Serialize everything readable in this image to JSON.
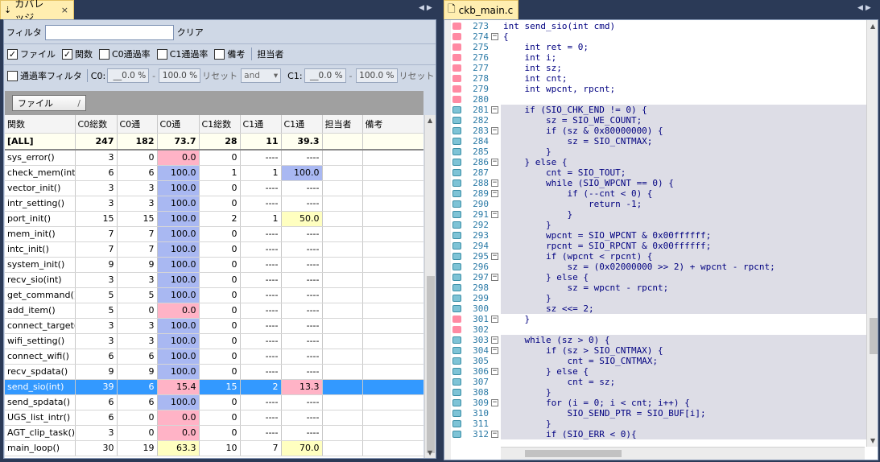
{
  "left_tab": {
    "title": "カバレッジ",
    "pin": "⇣",
    "close": "×"
  },
  "right_tab": {
    "title": "ckb_main.c"
  },
  "filter": {
    "label": "フィルタ",
    "value": "",
    "clear": "クリア"
  },
  "checks": [
    {
      "label": "ファイル",
      "checked": true
    },
    {
      "label": "関数",
      "checked": true
    },
    {
      "label": "C0通過率",
      "checked": false
    },
    {
      "label": "C1通過率",
      "checked": false
    },
    {
      "label": "備考",
      "checked": false
    }
  ],
  "owner_label": "担当者",
  "rate_filter": {
    "label": "通過率フィルタ",
    "c0_label": "C0:",
    "c0_min": "__0.0 %",
    "c0_max": "100.0 %",
    "reset": "リセット",
    "combine": "and",
    "c1_label": "C1:",
    "c1_min": "__0.0 %",
    "c1_max": "100.0 %",
    "reset2": "リセット",
    "dash": "-"
  },
  "file_button": "ファイル",
  "table": {
    "headers": [
      "関数",
      "C0総数",
      "C0通",
      "C0通",
      "C1総数",
      "C1通",
      "C1通",
      "担当者",
      "備考"
    ],
    "all_row": [
      "[ALL]",
      "247",
      "182",
      "73.7",
      "28",
      "11",
      "39.3",
      "",
      ""
    ],
    "rows": [
      [
        "sys_error()",
        "3",
        "0",
        "0.0",
        "0",
        "----",
        "----"
      ],
      [
        "check_mem(int)",
        "6",
        "6",
        "100.0",
        "1",
        "1",
        "100.0"
      ],
      [
        "vector_init()",
        "3",
        "3",
        "100.0",
        "0",
        "----",
        "----"
      ],
      [
        "intr_setting()",
        "3",
        "3",
        "100.0",
        "0",
        "----",
        "----"
      ],
      [
        "port_init()",
        "15",
        "15",
        "100.0",
        "2",
        "1",
        "50.0"
      ],
      [
        "mem_init()",
        "7",
        "7",
        "100.0",
        "0",
        "----",
        "----"
      ],
      [
        "intc_init()",
        "7",
        "7",
        "100.0",
        "0",
        "----",
        "----"
      ],
      [
        "system_init()",
        "9",
        "9",
        "100.0",
        "0",
        "----",
        "----"
      ],
      [
        "recv_sio(int)",
        "3",
        "3",
        "100.0",
        "0",
        "----",
        "----"
      ],
      [
        "get_command()",
        "5",
        "5",
        "100.0",
        "0",
        "----",
        "----"
      ],
      [
        "add_item()",
        "5",
        "0",
        "0.0",
        "0",
        "----",
        "----"
      ],
      [
        "connect_target()",
        "3",
        "3",
        "100.0",
        "0",
        "----",
        "----"
      ],
      [
        "wifi_setting()",
        "3",
        "3",
        "100.0",
        "0",
        "----",
        "----"
      ],
      [
        "connect_wifi()",
        "6",
        "6",
        "100.0",
        "0",
        "----",
        "----"
      ],
      [
        "recv_spdata()",
        "9",
        "9",
        "100.0",
        "0",
        "----",
        "----"
      ],
      [
        "send_sio(int)",
        "39",
        "6",
        "15.4",
        "15",
        "2",
        "13.3"
      ],
      [
        "send_spdata()",
        "6",
        "6",
        "100.0",
        "0",
        "----",
        "----"
      ],
      [
        "UGS_list_intr()",
        "6",
        "0",
        "0.0",
        "0",
        "----",
        "----"
      ],
      [
        "AGT_clip_task()",
        "3",
        "0",
        "0.0",
        "0",
        "----",
        "----"
      ],
      [
        "main_loop()",
        "30",
        "19",
        "63.3",
        "10",
        "7",
        "70.0"
      ]
    ]
  },
  "code": [
    {
      "n": "273",
      "t": "int send_sio(int cmd)"
    },
    {
      "n": "274",
      "t": "{"
    },
    {
      "n": "275",
      "t": "    int ret = 0;"
    },
    {
      "n": "276",
      "t": "    int i;"
    },
    {
      "n": "277",
      "t": "    int sz;"
    },
    {
      "n": "278",
      "t": "    int cnt;"
    },
    {
      "n": "279",
      "t": "    int wpcnt, rpcnt;"
    },
    {
      "n": "280",
      "t": ""
    },
    {
      "n": "281",
      "t": "    if (SIO_CHK_END != 0) {"
    },
    {
      "n": "282",
      "t": "        sz = SIO_WE_COUNT;"
    },
    {
      "n": "283",
      "t": "        if (sz & 0x80000000) {"
    },
    {
      "n": "284",
      "t": "            sz = SIO_CNTMAX;"
    },
    {
      "n": "285",
      "t": "        }"
    },
    {
      "n": "286",
      "t": "    } else {"
    },
    {
      "n": "287",
      "t": "        cnt = SIO_TOUT;"
    },
    {
      "n": "288",
      "t": "        while (SIO_WPCNT == 0) {"
    },
    {
      "n": "289",
      "t": "            if (--cnt < 0) {"
    },
    {
      "n": "290",
      "t": "                return -1;"
    },
    {
      "n": "291",
      "t": "            }"
    },
    {
      "n": "292",
      "t": "        }"
    },
    {
      "n": "293",
      "t": "        wpcnt = SIO_WPCNT & 0x00ffffff;"
    },
    {
      "n": "294",
      "t": "        rpcnt = SIO_RPCNT & 0x00ffffff;"
    },
    {
      "n": "295",
      "t": "        if (wpcnt < rpcnt) {"
    },
    {
      "n": "296",
      "t": "            sz = (0x02000000 >> 2) + wpcnt - rpcnt;"
    },
    {
      "n": "297",
      "t": "        } else {"
    },
    {
      "n": "298",
      "t": "            sz = wpcnt - rpcnt;"
    },
    {
      "n": "299",
      "t": "        }"
    },
    {
      "n": "300",
      "t": "        sz <<= 2;"
    },
    {
      "n": "301",
      "t": "    }"
    },
    {
      "n": "302",
      "t": ""
    },
    {
      "n": "303",
      "t": "    while (sz > 0) {"
    },
    {
      "n": "304",
      "t": "        if (sz > SIO_CNTMAX) {"
    },
    {
      "n": "305",
      "t": "            cnt = SIO_CNTMAX;"
    },
    {
      "n": "306",
      "t": "        } else {"
    },
    {
      "n": "307",
      "t": "            cnt = sz;"
    },
    {
      "n": "308",
      "t": "        }"
    },
    {
      "n": "309",
      "t": "        for (i = 0; i < cnt; i++) {"
    },
    {
      "n": "310",
      "t": "            SIO_SEND_PTR = SIO_BUF[i];"
    },
    {
      "n": "311",
      "t": "        }"
    },
    {
      "n": "312",
      "t": "        if (SIO_ERR < 0){"
    }
  ],
  "colors": {
    "covered_bg": "#dddde6",
    "uncovered_bg": "#ffffff",
    "selection": "#3399ff",
    "pct_zero": "#ffb3c6",
    "pct_full": "#a9b8f2",
    "pct_partial": "#ffffc0"
  }
}
